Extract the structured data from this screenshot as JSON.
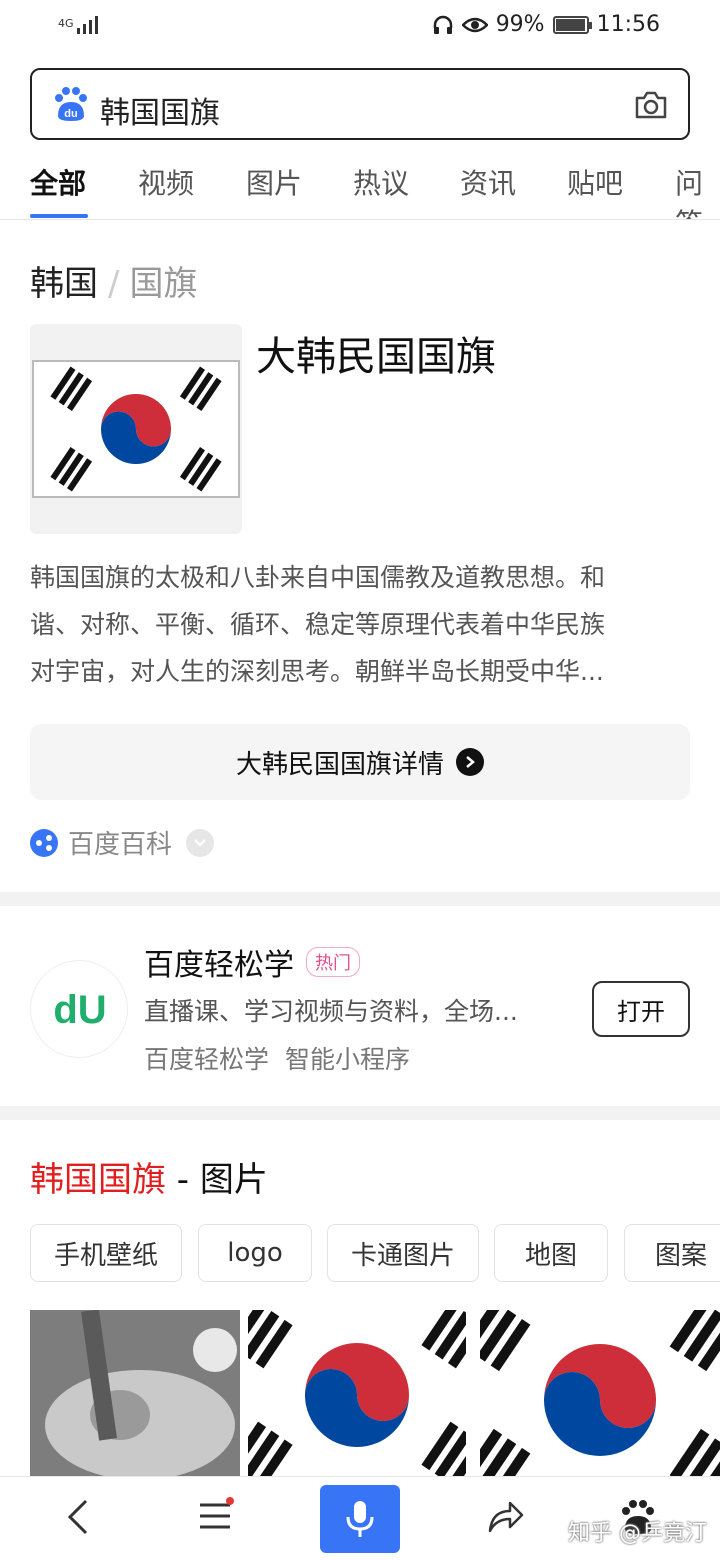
{
  "status": {
    "network": "4G",
    "battery": "99%",
    "battery_level": 0.99,
    "time": "11:56"
  },
  "search": {
    "query": "韩国国旗",
    "icons": [
      "baidu-paw-icon",
      "camera-icon"
    ]
  },
  "tabs": [
    {
      "label": "全部",
      "active": true
    },
    {
      "label": "视频"
    },
    {
      "label": "图片"
    },
    {
      "label": "热议"
    },
    {
      "label": "资讯"
    },
    {
      "label": "贴吧"
    },
    {
      "label": "问答"
    }
  ],
  "entity": {
    "breadcrumb": [
      "韩国",
      "国旗"
    ],
    "title": "大韩民国国旗",
    "description_lines": [
      "韩国国旗的太极和八卦来自中国儒教及道教思想。和",
      "谐、对称、平衡、循环、稳定等原理代表着中华民族",
      "对宇宙，对人生的深刻思考。朝鲜半岛长期受中华..."
    ],
    "detail_button": "大韩民国国旗详情",
    "source": "百度百科"
  },
  "app": {
    "name": "百度轻松学",
    "badge": "热门",
    "description": "直播课、学习视频与资料，全场...",
    "sub": [
      "百度轻松学",
      "智能小程序"
    ],
    "open_button": "打开"
  },
  "images": {
    "title_highlight": "韩国国旗",
    "title_rest": " - 图片",
    "chips": [
      "手机壁纸",
      "logo",
      "卡通图片",
      "地图",
      "图案"
    ]
  },
  "bottom_bar": {
    "icons": [
      "back-icon",
      "menu-icon",
      "mic-icon",
      "share-icon",
      "baidu-paw-icon"
    ]
  },
  "watermark": "知乎 @乒竟汀",
  "colors": {
    "accent": "#3875f6",
    "highlight_red": "#e02020",
    "flag_red": "#cd2e3a",
    "flag_blue": "#0047a0"
  }
}
